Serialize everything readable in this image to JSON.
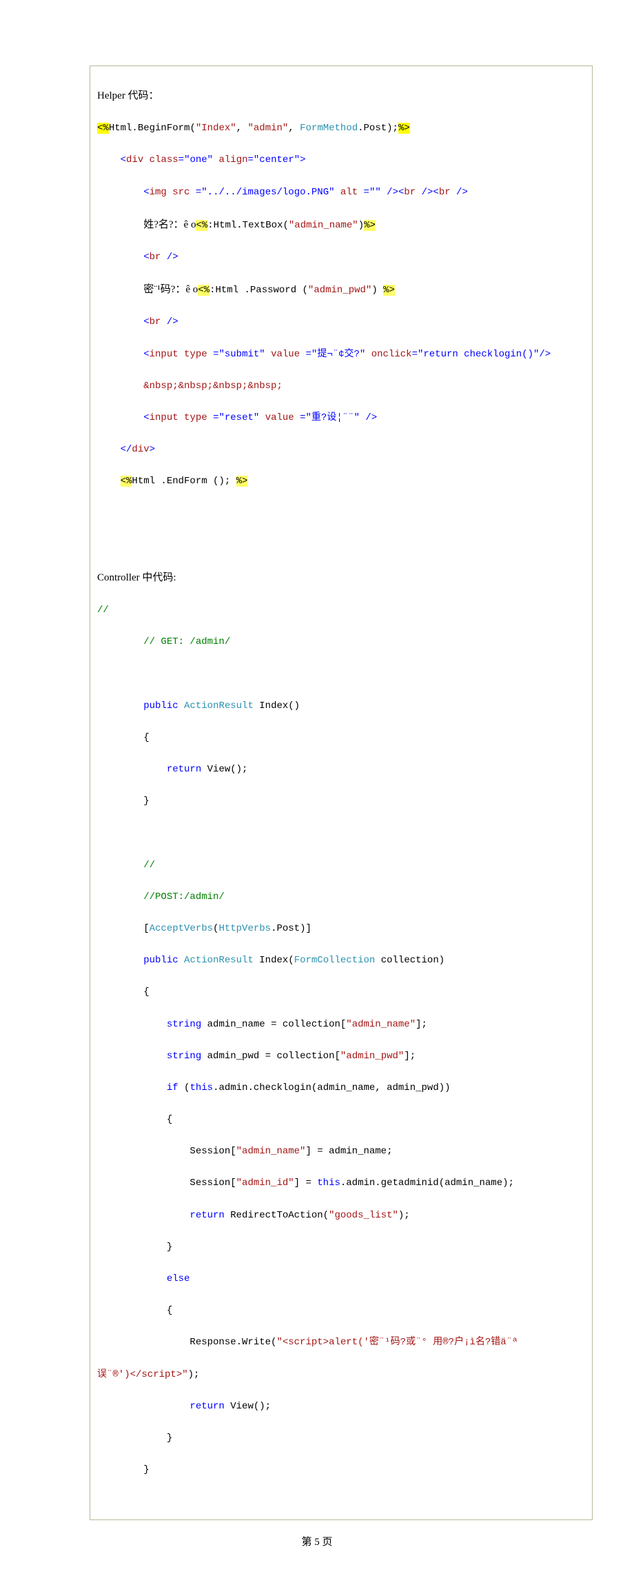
{
  "header1": "Helper 代码：",
  "controllerHeader": "Controller 中代码:",
  "footer": "第 5 页",
  "tokens": {
    "lt": "<%",
    "gt": "%>",
    "ltc": "<%",
    "gtc": "%>",
    "html": "Html.",
    "beginForm": "BeginForm",
    "index": "\"Index\"",
    "admin": "\"admin\"",
    "formMethod": "FormMethod",
    "post": ".Post);",
    "divOpen1": "<",
    "div": "div",
    "classAttr": "class",
    "oneVal": "\"one\"",
    "alignAttr": "align",
    "centerVal": "\"center\"",
    "gtChar": ">",
    "imgOpen": "<",
    "img": "img",
    "srcAttr": "src",
    "srcVal": "\"../../images/logo.PNG\"",
    "altAttr": "alt",
    "altVal": "\"\"",
    "selfClose": " />",
    "brOpen": "<",
    "br": "br",
    "nameLabel": "姓?名?：ê o",
    "textBox": ":Html.TextBox(",
    "adminName": "\"admin_name\"",
    "rparen": ")",
    "pwdLabel": "密¨¹码?：ê o",
    "passwordFn": ":Html .Password (",
    "adminPwd": "\"admin_pwd\"",
    "rparenSp": ") ",
    "input": "input",
    "typeAttr": "type",
    "submitVal": "\"submit\"",
    "valueAttr": "value",
    "submitText": "\"提¬¨¢交?\"",
    "onclickAttr": "onclick",
    "onclickVal": "\"return checklogin()\"",
    "nbsp": "&nbsp;&nbsp;&nbsp;&nbsp;",
    "resetVal": "\"reset\"",
    "resetText": "\"重?设¦¨¨\"",
    "divClose": "</",
    "endForm": "Html .EndForm (); ",
    "slashSlash": "//",
    "getComment": "// GET: /admin/",
    "public": "public",
    "actionResult": "ActionResult",
    "indexFn": " Index()",
    "lbrace": "{",
    "rbrace": "}",
    "return": "return",
    "view": " View();",
    "postComment": "//POST:/admin/",
    "acceptVerbs": "AcceptVerbs",
    "httpVerbs": "HttpVerbs",
    "dotPost": ".Post)]",
    "indexFn2": " Index(",
    "formCollection": "FormCollection",
    "collection": " collection)",
    "string": "string",
    "adminNameVar": " admin_name = collection[",
    "adminPwdVar": " admin_pwd = collection[",
    "closeBr": "];",
    "if": "if",
    "this": "this",
    "checkLogin": ".admin.checklogin(admin_name, admin_pwd))",
    "session1": "Session[",
    "sessionAdminName": "\"admin_name\"",
    "sessionSet1": "] = admin_name;",
    "sessionAdminId": "\"admin_id\"",
    "sessionSet2": "] = ",
    "getAdminId": ".admin.getadminid(admin_name);",
    "redirect": " RedirectToAction(",
    "goodsList": "\"goods_list\"",
    "rparenSemi": ");",
    "else": "else",
    "responseWrite": "Response.Write(",
    "scriptStr1": "\"<script>alert('密¨¹码?或¨° 用®?户¡ì名?错ä¨ª",
    "scriptStr2": "误¨®')</script>\"",
    "lbracket": "[",
    "openParen": "("
  }
}
